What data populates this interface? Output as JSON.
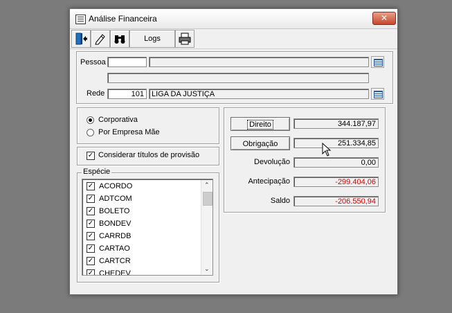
{
  "window": {
    "title": "Análise Financeira",
    "close_glyph": "✕"
  },
  "toolbar": {
    "exit_icon": "exit-door-icon",
    "edit_icon": "pencil-icon",
    "search_icon": "binoculars-icon",
    "logs_label": "Logs",
    "print_icon": "printer-icon"
  },
  "filters": {
    "pessoa_label": "Pessoa",
    "pessoa_code": "",
    "pessoa_name": "",
    "pessoa_extra": "",
    "rede_label": "Rede",
    "rede_code": "101",
    "rede_name": "LIGA DA JUSTIÇA"
  },
  "options": {
    "radio_corporativa": "Corporativa",
    "radio_empresa_mae": "Por Empresa Mãe",
    "selected": "Corporativa",
    "checkbox_provisao": "Considerar títulos de provisão",
    "checkbox_provisao_checked": true
  },
  "especie": {
    "title": "Espécie",
    "items": [
      {
        "label": "ACORDO",
        "checked": true
      },
      {
        "label": "ADTCOM",
        "checked": true
      },
      {
        "label": "BOLETO",
        "checked": true
      },
      {
        "label": "BONDEV",
        "checked": true
      },
      {
        "label": "CARRDB",
        "checked": true
      },
      {
        "label": "CARTAO",
        "checked": true
      },
      {
        "label": "CARTCR",
        "checked": true
      },
      {
        "label": "CHEDEV",
        "checked": true
      }
    ]
  },
  "summary": {
    "direito_label": "Direito",
    "direito_value": "344.187,97",
    "obrigacao_label": "Obrigação",
    "obrigacao_value": "251.334,85",
    "devolucao_label": "Devolução",
    "devolucao_value": "0,00",
    "antecipacao_label": "Antecipação",
    "antecipacao_value": "-299.404,06",
    "saldo_label": "Saldo",
    "saldo_value": "-206.550,94"
  },
  "colors": {
    "negative": "#d40000",
    "background": "#7b7b7b",
    "window": "#f0f0f0"
  }
}
